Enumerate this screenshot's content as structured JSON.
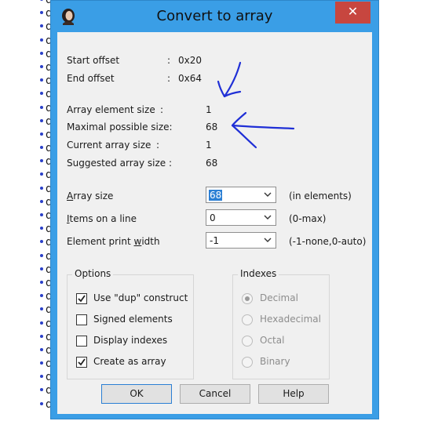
{
  "background": {
    "column_letter": "d"
  },
  "window": {
    "title": "Convert to array",
    "close_glyph": "✕"
  },
  "info": [
    {
      "label": "Start offset",
      "sep": ":",
      "value": "0x20"
    },
    {
      "label": "End offset",
      "sep": ":",
      "value": "0x64"
    },
    {
      "label": "Array element size",
      "sep": ":",
      "value": "1"
    },
    {
      "label": "Maximal possible size:",
      "sep": "",
      "value": "68"
    },
    {
      "label": "Current array size",
      "sep": ":",
      "value": "1"
    },
    {
      "label": "Suggested array size :",
      "sep": "",
      "value": "68"
    }
  ],
  "fields": {
    "array_size": {
      "label_u": "A",
      "label_rest": "rray size",
      "value": "68",
      "hint": "(in elements)"
    },
    "items_on_line": {
      "label_u": "I",
      "label_rest": "tems on a line",
      "value": "0",
      "hint": "(0-max)"
    },
    "print_width": {
      "label_pre": "Element print ",
      "label_u": "w",
      "label_rest": "idth",
      "value": "-1",
      "hint": "(-1-none,0-auto)"
    }
  },
  "options": {
    "title": "Options",
    "items": [
      {
        "label": "Use \"dup\" construct",
        "checked": true
      },
      {
        "label": "Signed elements",
        "checked": false
      },
      {
        "label": "Display indexes",
        "checked": false
      },
      {
        "label": "Create as array",
        "checked": true
      }
    ]
  },
  "indexes": {
    "title": "Indexes",
    "items": [
      {
        "label": "Decimal",
        "selected": true
      },
      {
        "label": "Hexadecimal",
        "selected": false
      },
      {
        "label": "Octal",
        "selected": false
      },
      {
        "label": "Binary",
        "selected": false
      }
    ]
  },
  "buttons": {
    "ok": "OK",
    "cancel": "Cancel",
    "help": "Help"
  },
  "annotation_color": "#1f2fd6",
  "colors": {
    "title_bar": "#3a9ee6",
    "close": "#c7463f",
    "selection": "#2b7fd4"
  }
}
